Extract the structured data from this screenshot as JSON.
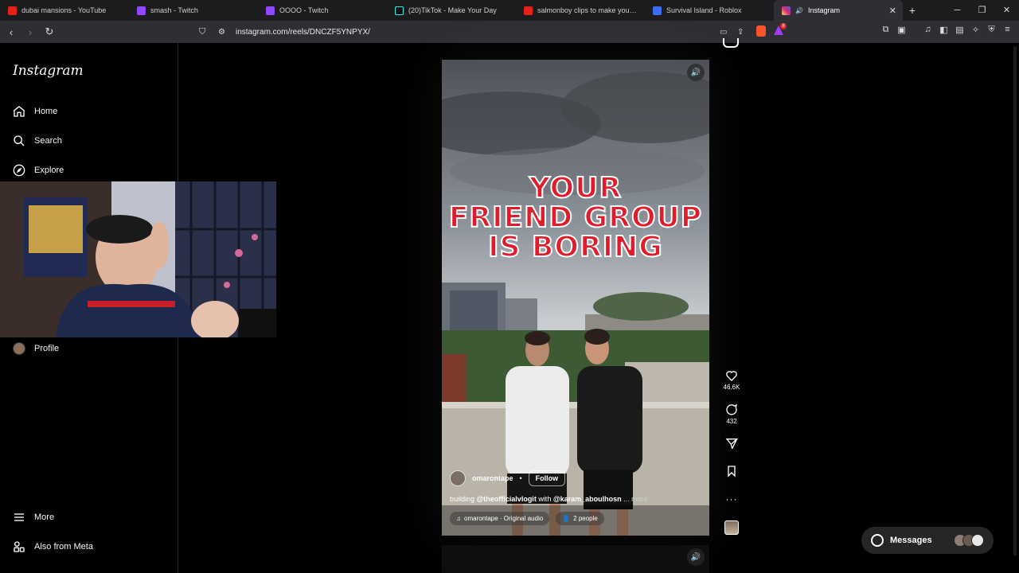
{
  "browser": {
    "tabs": [
      {
        "title": "dubai mansions - YouTube",
        "color": "#e62117"
      },
      {
        "title": "smash - Twitch",
        "color": "#9146ff"
      },
      {
        "title": "OOOO - Twitch",
        "color": "#9146ff"
      },
      {
        "title": "(20)TikTok - Make Your Day",
        "color": "#111111"
      },
      {
        "title": "salmonboy clips to make you scream",
        "color": "#e62117"
      },
      {
        "title": "Survival Island - Roblox",
        "color": "#3a6df0"
      },
      {
        "title": "Instagram",
        "color": "#d62976"
      }
    ],
    "url": "instagram.com/reels/DNCZF5YNPYX/",
    "notification_count": "8"
  },
  "sidebar": {
    "logo": "Instagram",
    "items": [
      {
        "label": "Home",
        "icon": "home-icon"
      },
      {
        "label": "Search",
        "icon": "search-icon"
      },
      {
        "label": "Explore",
        "icon": "compass-icon"
      },
      {
        "label": "Profile",
        "icon": "avatar"
      }
    ],
    "bottom": [
      {
        "label": "More",
        "icon": "menu-icon"
      },
      {
        "label": "Also from Meta",
        "icon": "meta-apps-icon"
      }
    ]
  },
  "reel": {
    "overlay_lines": [
      "YOUR",
      "FRIEND GROUP",
      "IS BORING"
    ],
    "username": "omarontape",
    "separator": "•",
    "follow_label": "Follow",
    "caption_prefix": "building ",
    "caption_mention1": "@theofficialvlogit",
    "caption_mid": " with ",
    "caption_mention2": "@karam_aboulhosn",
    "caption_more": " ... more",
    "audio": "omarontape · Original audio",
    "people": "2 people"
  },
  "actions": {
    "likes": "46.6K",
    "comments": "432"
  },
  "messages": {
    "label": "Messages"
  }
}
